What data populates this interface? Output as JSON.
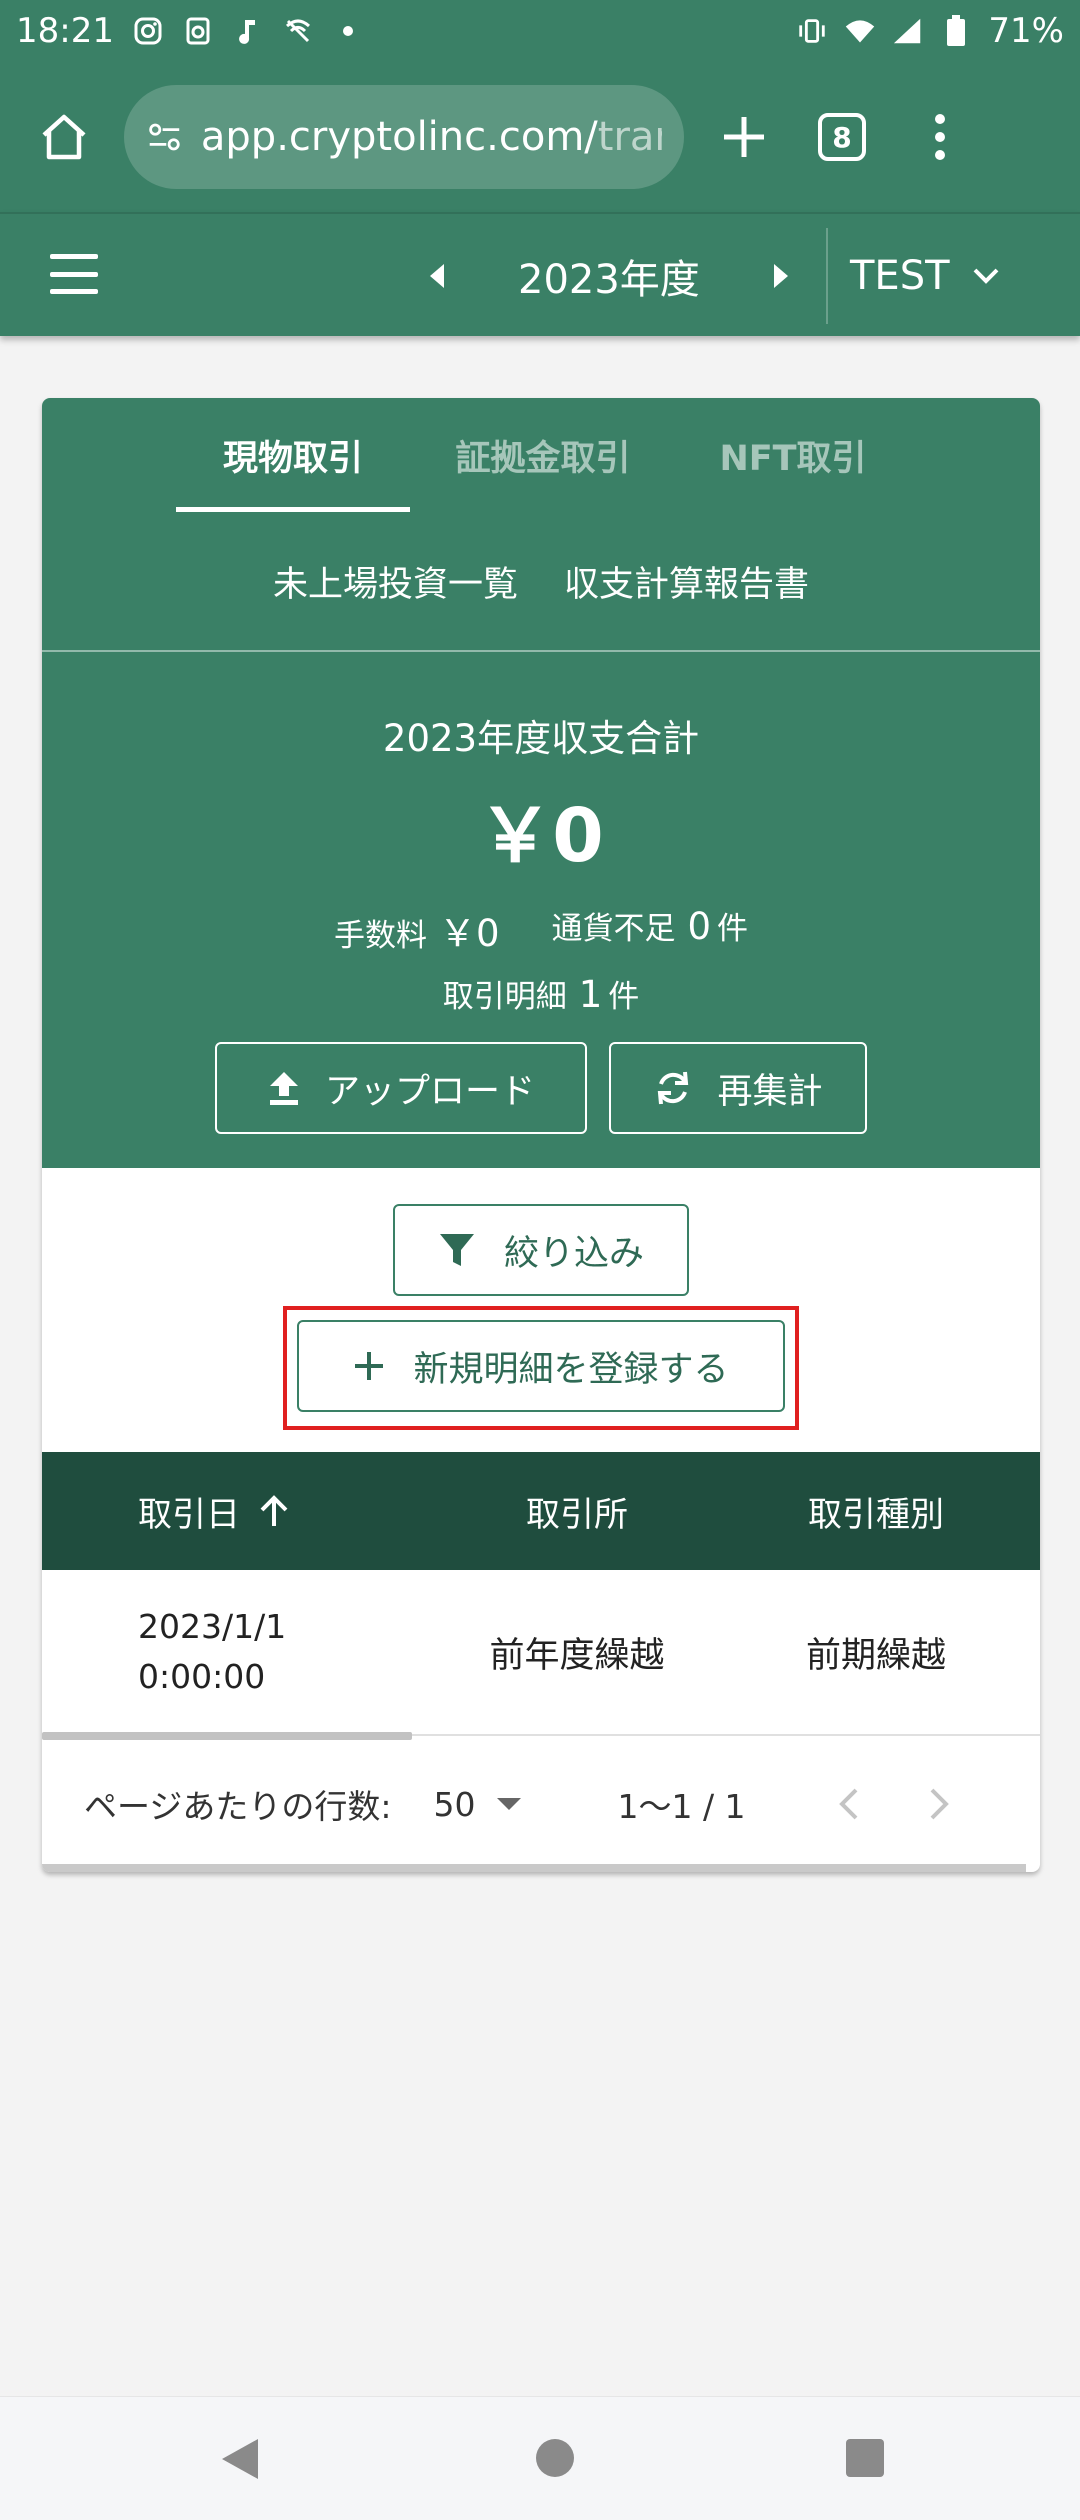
{
  "status_bar": {
    "time": "18:21",
    "battery": "71%"
  },
  "browser": {
    "url_main": "app.cryptolinc.com/",
    "url_dim": "trans",
    "tab_count": "8"
  },
  "app_bar": {
    "year": "2023年度",
    "account": "TEST"
  },
  "tabs": [
    {
      "label": "現物取引",
      "active": true
    },
    {
      "label": "証拠金取引",
      "active": false
    },
    {
      "label": "NFT取引",
      "active": false
    }
  ],
  "sublinks": [
    "未上場投資一覧",
    "収支計算報告書"
  ],
  "summary": {
    "title": "2023年度収支合計",
    "total": "￥0",
    "fee_label": "手数料",
    "fee_value": "￥0",
    "shortage_label": "通貨不足",
    "shortage_value": "0",
    "shortage_unit": "件",
    "detail_label": "取引明細",
    "detail_value": "1",
    "detail_unit": "件"
  },
  "actions": {
    "upload": "アップロード",
    "recalc": "再集計",
    "filter": "絞り込み",
    "new_entry": "新規明細を登録する"
  },
  "table": {
    "headers": [
      "取引日",
      "取引所",
      "取引種別"
    ],
    "rows": [
      {
        "date": "2023/1/1",
        "time": "0:00:00",
        "exchange": "前年度繰越",
        "type": "前期繰越"
      }
    ]
  },
  "pager": {
    "rows_per_page_label": "ページあたりの行数:",
    "rows_per_page": "50",
    "range": "1〜1 / 1"
  },
  "colors": {
    "primary": "#3a8066",
    "header_dark": "#1f4d3e",
    "highlight": "#e02020"
  }
}
